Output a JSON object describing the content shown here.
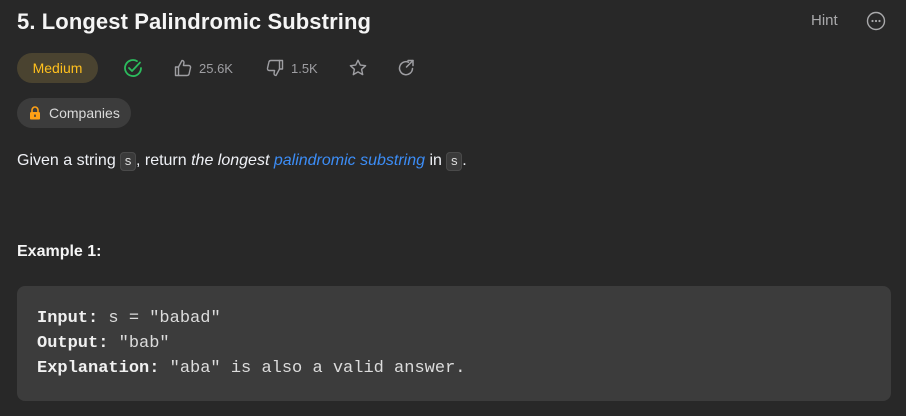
{
  "problem": {
    "title": "5. Longest Palindromic Substring",
    "hint_label": "Hint",
    "difficulty": "Medium",
    "likes": "25.6K",
    "dislikes": "1.5K",
    "companies_label": "Companies"
  },
  "description": {
    "pre": "Given a string ",
    "var1": "s",
    "mid": ", return ",
    "emph": "the longest",
    "link": "palindromic substring",
    "post": " in ",
    "var2": "s",
    "end": "."
  },
  "example": {
    "heading": "Example 1:",
    "input_label": "Input:",
    "input_value": "s = \"babad\"",
    "output_label": "Output:",
    "output_value": "\"bab\"",
    "explanation_label": "Explanation:",
    "explanation_value": "\"aba\" is also a valid answer."
  },
  "colors": {
    "background": "#282828",
    "difficulty_medium": "#ffc01e",
    "solved_check": "#2cbb5d",
    "link": "#3c8df6",
    "lock": "#ffa116"
  },
  "icons": {
    "solved": "check-circle-icon",
    "like": "thumbs-up-icon",
    "dislike": "thumbs-down-icon",
    "favorite": "star-icon",
    "share": "share-icon",
    "lock": "lock-icon",
    "more": "more-icon"
  }
}
